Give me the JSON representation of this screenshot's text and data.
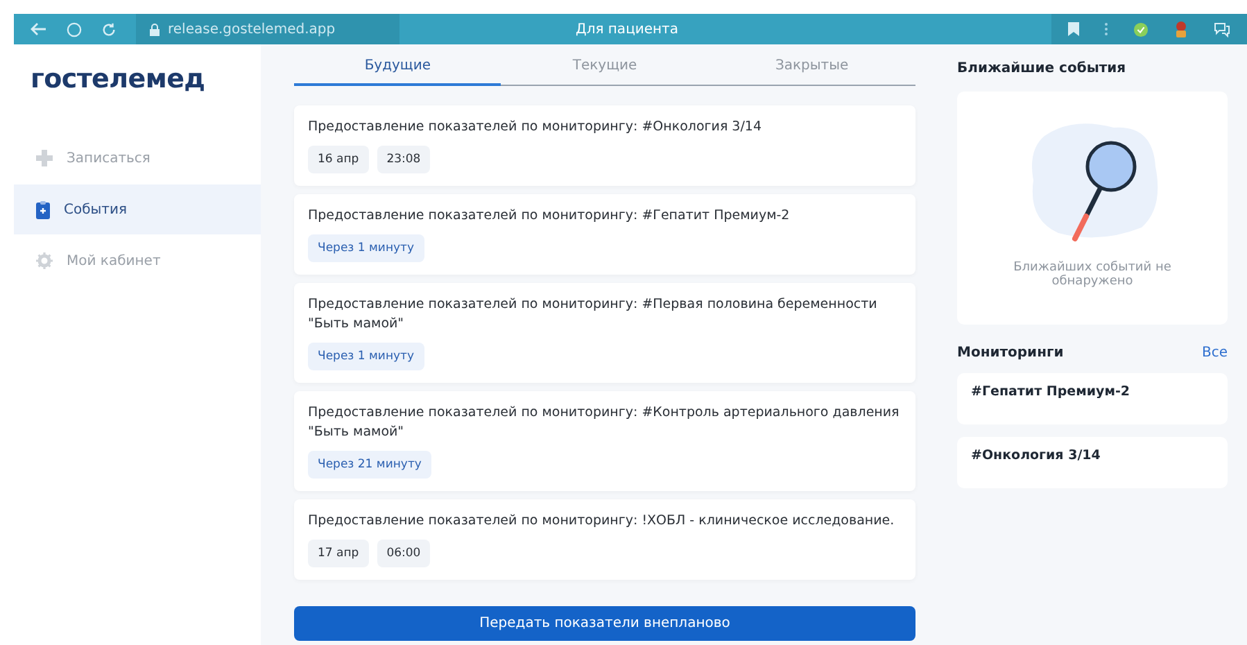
{
  "browser": {
    "url": "release.gostelemed.app",
    "title": "Для пациента"
  },
  "logo": "гостелемед",
  "sidebar": {
    "items": [
      {
        "label": "Записаться",
        "kind": "plus",
        "selected": false
      },
      {
        "label": "События",
        "kind": "clipboard",
        "selected": true
      },
      {
        "label": "Мой кабинет",
        "kind": "gear",
        "selected": false
      }
    ]
  },
  "tabs": [
    {
      "label": "Будущие",
      "selected": true
    },
    {
      "label": "Текущие",
      "selected": false
    },
    {
      "label": "Закрытые",
      "selected": false
    }
  ],
  "events": [
    {
      "title": "Предоставление показателей по мониторингу: #Онкология 3/14",
      "chips": [
        {
          "kind": "date",
          "text": "16 апр"
        },
        {
          "kind": "date",
          "text": "23:08"
        }
      ]
    },
    {
      "title": "Предоставление показателей по мониторингу: #Гепатит Премиум-2",
      "chips": [
        {
          "kind": "relative",
          "text": "Через 1 минуту"
        }
      ]
    },
    {
      "title": "Предоставление показателей по мониторингу: #Первая половина беременности \"Быть мамой\"",
      "chips": [
        {
          "kind": "relative",
          "text": "Через 1 минуту"
        }
      ]
    },
    {
      "title": "Предоставление показателей по мониторингу: #Контроль артериального давления \"Быть мамой\"",
      "chips": [
        {
          "kind": "relative",
          "text": "Через 21 минуту"
        }
      ]
    },
    {
      "title": "Предоставление показателей по мониторингу: !ХОБЛ - клиническое исследование.",
      "chips": [
        {
          "kind": "date",
          "text": "17 апр"
        },
        {
          "kind": "date",
          "text": "06:00"
        }
      ]
    }
  ],
  "submit_button": "Передать показатели внепланово",
  "upcoming": {
    "title": "Ближайшие события",
    "empty_text": "Ближайших событий не обнаружено"
  },
  "monitorings": {
    "title": "Мониторинги",
    "all_link": "Все",
    "items": [
      "#Гепатит Премиум-2",
      "#Онкология 3/14"
    ]
  }
}
